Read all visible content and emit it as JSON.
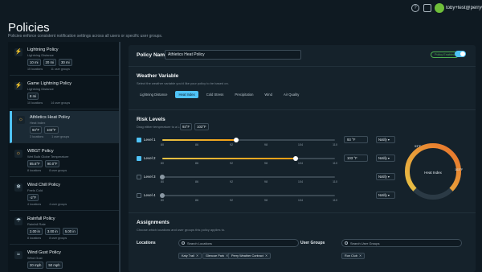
{
  "app": {
    "title": "Policies",
    "subtitle": "Policies enforce consistent notification settings across all users or specific user groups.",
    "user_email": "toby+test@perryweather.com"
  },
  "topbar": {
    "help_icon": "?",
    "bell_icon": "bell-icon"
  },
  "sidebar": {
    "policies": [
      {
        "name": "Lightning Policy",
        "sub": "Lightning Distance",
        "chips": [
          "10 mi",
          "20 mi",
          "30 mi"
        ],
        "meta": [
          "15 locations",
          "11 user groups"
        ],
        "icon": "⚡"
      },
      {
        "name": "Game Lightning Policy",
        "sub": "Lightning Distance",
        "chips": [
          "8 mi"
        ],
        "meta": [
          "10 locations",
          "14 user groups"
        ],
        "icon": "⚡"
      },
      {
        "name": "Athletics Heat Policy",
        "sub": "Heat Index",
        "chips": [
          "93°F",
          "103°F"
        ],
        "meta": [
          "3 locations",
          "1 user groups"
        ],
        "icon": "☼"
      },
      {
        "name": "WBGT Policy",
        "sub": "Wet Bulb Globe Temperature",
        "chips": [
          "85.6°F",
          "90.0°F"
        ],
        "meta": [
          "8 locations",
          "8 user groups"
        ],
        "icon": "☼"
      },
      {
        "name": "Wind Chill Policy",
        "sub": "Feels Cold",
        "chips": [
          "-2°F"
        ],
        "meta": [
          "4 locations",
          "4 user groups"
        ],
        "icon": "❄"
      },
      {
        "name": "Rainfall Policy",
        "sub": "Rainfall Rate",
        "chips": [
          "2.00 in",
          "3.00 in",
          "5.00 in"
        ],
        "meta": [
          "8 locations",
          "8 user groups"
        ],
        "icon": "☂"
      },
      {
        "name": "Wind Gust Policy",
        "sub": "Wind Gust",
        "chips": [
          "20 mph",
          "50 mph"
        ],
        "meta": [],
        "icon": "≈"
      }
    ]
  },
  "main": {
    "policy_name_label": "Policy Name",
    "policy_name_value": "Athletics Heat Policy",
    "enabled_label": "Policy Enabled",
    "weather_variable": {
      "title": "Weather Variable",
      "desc": "Select the weather variable you'd like your policy to be based on.",
      "tabs": [
        "Lightning Distance",
        "Heat Index",
        "Cold Stress",
        "Precipitation",
        "Wind",
        "Air Quality"
      ],
      "selected": "Heat Index"
    },
    "risk_levels": {
      "title": "Risk Levels",
      "desc": "Drag either temperature to a Level",
      "temps": [
        "93°F",
        "103°F"
      ],
      "ticks": [
        "80",
        "86",
        "92",
        "98",
        "104",
        "110"
      ],
      "levels": [
        {
          "label": "Level 1",
          "checked": true,
          "value": "93 °F",
          "fill": 0.43,
          "notify": "Notify"
        },
        {
          "label": "Level 2",
          "checked": true,
          "value": "103 °F",
          "fill": 0.77,
          "notify": "Notify"
        },
        {
          "label": "Level 3",
          "checked": false,
          "value": "",
          "fill": 0,
          "notify": "Notify"
        },
        {
          "label": "Level 4",
          "checked": false,
          "value": "",
          "fill": 0,
          "notify": "Notify"
        }
      ]
    },
    "gauge": {
      "label": "Heat Index",
      "low": "93°F",
      "high": "103°F"
    },
    "assignments": {
      "title": "Assignments",
      "desc": "Choose which locations and user groups this policy applies to.",
      "locations_label": "Locations",
      "locations_placeholder": "Search Locations",
      "location_tags": [
        "Katy Trail",
        "Glencoe Park",
        "Perry Weather Contract"
      ],
      "user_groups_label": "User Groups",
      "user_groups_placeholder": "Search User Groups",
      "user_group_tags": [
        "Run Club"
      ]
    }
  },
  "colors": {
    "accent": "#4fc3f7",
    "enabled": "#4caf50",
    "gauge_low": "#e8c245",
    "gauge_high": "#e8702a"
  }
}
